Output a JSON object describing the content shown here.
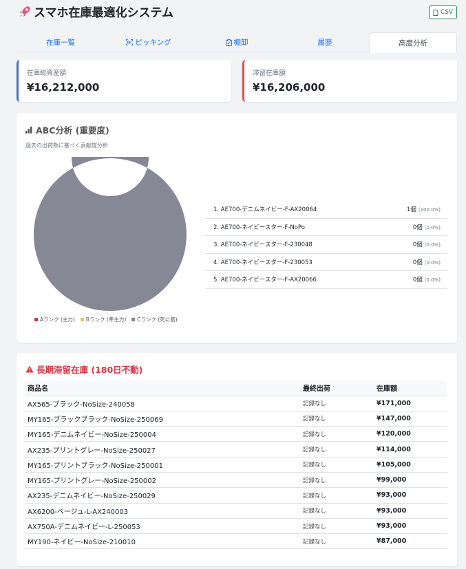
{
  "app": {
    "title": "スマホ在庫最適化システム",
    "csv_label": "CSV"
  },
  "tabs": [
    {
      "label": "在庫一覧",
      "icon": ""
    },
    {
      "label": "ピッキング",
      "icon": "barcode-icon"
    },
    {
      "label": "棚卸",
      "icon": "clipboard-icon"
    },
    {
      "label": "履歴",
      "icon": ""
    },
    {
      "label": "高度分析",
      "icon": "",
      "active": true
    }
  ],
  "stats": {
    "total_label": "在庫総資産額",
    "total_value": "¥16,212,000",
    "stale_label": "滞留在庫額",
    "stale_value": "¥16,206,000"
  },
  "abc": {
    "title": "ABC分析 (重要度)",
    "subtitle": "過去の出荷数に基づく貢献度分析",
    "legend": [
      {
        "label": "Aランク (主力)",
        "color": "#dc3545"
      },
      {
        "label": "Bランク (準主力)",
        "color": "#f0c14b"
      },
      {
        "label": "Cランク (死に筋)",
        "color": "#868896"
      }
    ],
    "ranking": [
      {
        "name": "1. AE700-デニムネイビー-F-AX20064",
        "qty": "1個",
        "pct": "(100.0%)"
      },
      {
        "name": "2. AE700-ネイビースター-F-NoPo",
        "qty": "0個",
        "pct": "(0.0%)"
      },
      {
        "name": "3. AE700-ネイビースター-F-230048",
        "qty": "0個",
        "pct": "(0.0%)"
      },
      {
        "name": "4. AE700-ネイビースター-F-230053",
        "qty": "0個",
        "pct": "(0.0%)"
      },
      {
        "name": "5. AE700-ネイビースター-F-AX20066",
        "qty": "0個",
        "pct": "(0.0%)"
      }
    ]
  },
  "chart_data": {
    "type": "pie",
    "categories": [
      "Aランク (主力)",
      "Bランク (準主力)",
      "Cランク (死に筋)"
    ],
    "values": [
      0,
      0,
      100
    ],
    "colors": [
      "#dc3545",
      "#f0c14b",
      "#868896"
    ],
    "legend_position": "bottom"
  },
  "stale": {
    "title": "長期滞留在庫 (180日不動)",
    "headers": [
      "商品名",
      "最終出荷",
      "在庫額"
    ],
    "rows": [
      [
        "AX565-ブラック-NoSize-240058",
        "記録なし",
        "¥171,000"
      ],
      [
        "MY165-ブラックブラック-NoSize-250069",
        "記録なし",
        "¥147,000"
      ],
      [
        "MY165-デニムネイビー-NoSize-250004",
        "記録なし",
        "¥120,000"
      ],
      [
        "AX235-プリントグレー-NoSize-250027",
        "記録なし",
        "¥114,000"
      ],
      [
        "MY165-プリントブラック-NoSize-250001",
        "記録なし",
        "¥105,000"
      ],
      [
        "MY165-プリントグレー-NoSize-250002",
        "記録なし",
        "¥99,000"
      ],
      [
        "AX235-デニムネイビー-NoSize-250029",
        "記録なし",
        "¥93,000"
      ],
      [
        "AX6200-ベージュ-L-AX240003",
        "記録なし",
        "¥93,000"
      ],
      [
        "AX750A-デニムネイビー-L-250053",
        "記録なし",
        "¥93,000"
      ],
      [
        "MY190-ネイビー-NoSize-210010",
        "記録なし",
        "¥87,000"
      ]
    ]
  }
}
